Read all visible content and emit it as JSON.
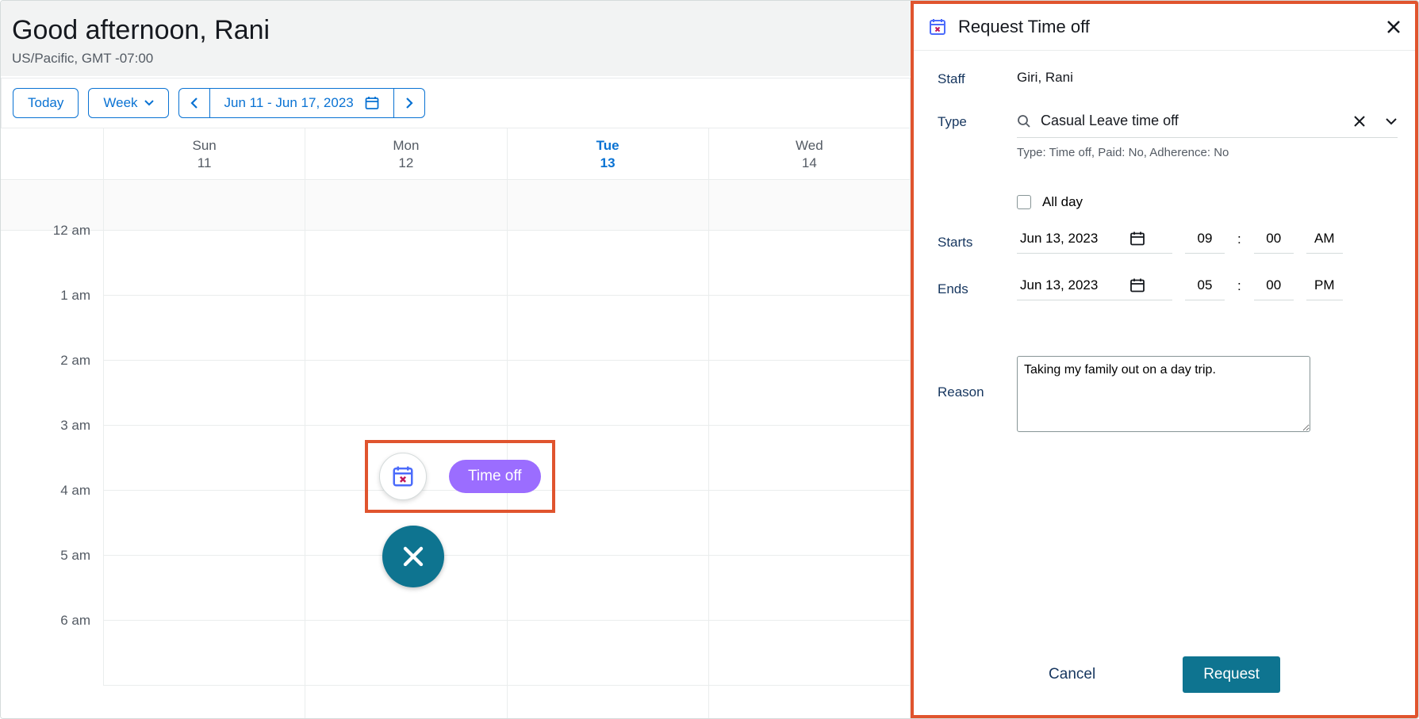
{
  "header": {
    "greeting": "Good afternoon, Rani",
    "timezone": "US/Pacific, GMT -07:00"
  },
  "toolbar": {
    "today_label": "Today",
    "view_label": "Week",
    "date_range": "Jun 11 - Jun 17, 2023"
  },
  "calendar": {
    "days": [
      {
        "dow": "Sun",
        "dom": "11",
        "active": false
      },
      {
        "dow": "Mon",
        "dom": "12",
        "active": false
      },
      {
        "dow": "Tue",
        "dom": "13",
        "active": true
      },
      {
        "dow": "Wed",
        "dom": "14",
        "active": false
      }
    ],
    "time_labels": [
      "12 am",
      "1 am",
      "2 am",
      "3 am",
      "4 am",
      "5 am",
      "6 am"
    ]
  },
  "floating": {
    "timeoff_label": "Time off"
  },
  "panel": {
    "title": "Request Time off",
    "staff_label": "Staff",
    "staff_value": "Giri, Rani",
    "type_label": "Type",
    "type_value": "Casual Leave time off",
    "type_meta": "Type: Time off, Paid: No, Adherence: No",
    "allday_label": "All day",
    "starts_label": "Starts",
    "ends_label": "Ends",
    "start_date": "Jun 13, 2023",
    "start_hour": "09",
    "start_min": "00",
    "start_ampm": "AM",
    "end_date": "Jun 13, 2023",
    "end_hour": "05",
    "end_min": "00",
    "end_ampm": "PM",
    "reason_label": "Reason",
    "reason_value": "Taking my family out on a day trip.",
    "cancel_label": "Cancel",
    "request_label": "Request"
  }
}
